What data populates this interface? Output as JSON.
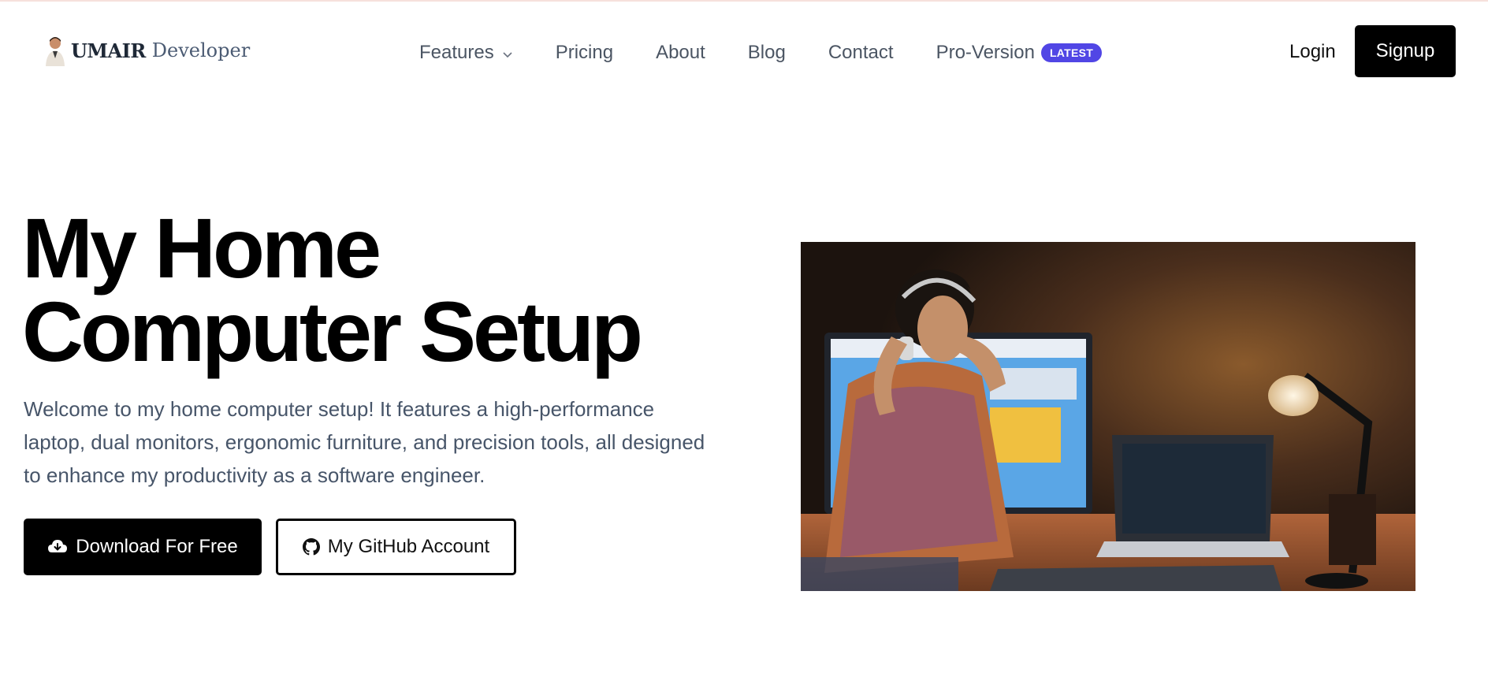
{
  "brand": {
    "name": "UMAIR",
    "suffix": "Developer"
  },
  "nav": {
    "items": [
      {
        "label": "Features",
        "has_dropdown": true,
        "icon": "chevron-down-icon"
      },
      {
        "label": "Pricing"
      },
      {
        "label": "About"
      },
      {
        "label": "Blog"
      },
      {
        "label": "Contact"
      },
      {
        "label": "Pro-Version",
        "badge": "LATEST"
      }
    ],
    "login": "Login",
    "signup": "Signup"
  },
  "hero": {
    "title_line1": "My Home",
    "title_line2": "Computer Setup",
    "description": "Welcome to my home computer setup! It features a high-performance laptop, dual monitors, ergonomic furniture, and precision tools, all designed to enhance my productivity as a software engineer.",
    "download_label": "Download For Free",
    "download_icon": "cloud-download-icon",
    "github_label": "My GitHub Account",
    "github_icon": "github-icon"
  },
  "colors": {
    "accent_badge": "#5146e5",
    "primary_button": "#000000",
    "body_text": "#475569",
    "nav_text": "#4b5563"
  }
}
